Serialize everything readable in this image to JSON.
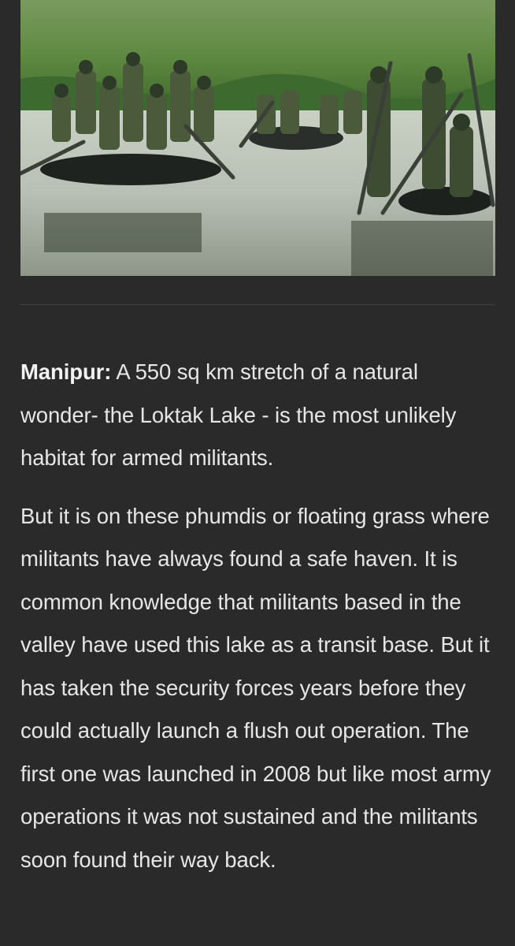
{
  "article": {
    "image": {
      "alt": "soldiers-in-boats-on-loktak-lake"
    },
    "paragraphs": [
      {
        "lead": "Manipur:",
        "text": " A 550 sq km stretch of a natural wonder- the Loktak Lake - is the most unlikely habitat for armed militants."
      },
      {
        "lead": "",
        "text": "But it is on these phumdis or floating grass where militants have always found a safe haven. It is common knowledge that militants based in the valley have used this lake as a transit base. But it has taken the security forces years before they could actually launch a flush out operation. The first one was launched in 2008 but like most army operations it was not sustained and the militants soon found their way back."
      }
    ]
  },
  "colors": {
    "background": "#2a2a2a",
    "text": "#e6e6e6",
    "divider": "#3e3e3e"
  }
}
